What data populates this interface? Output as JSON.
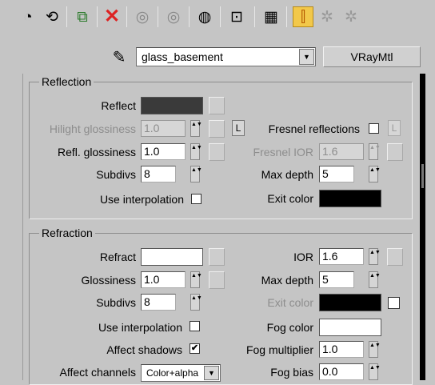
{
  "toolbar": {
    "icons": [
      {
        "name": "get-material-icon",
        "glyph": "◔"
      },
      {
        "name": "put-material-icon",
        "glyph": "⟲"
      },
      {
        "name": "assign-material-icon",
        "glyph": "⧉"
      },
      {
        "name": "reset-map-icon",
        "glyph": "✕"
      },
      {
        "name": "make-copy-icon",
        "glyph": "◎"
      },
      {
        "name": "make-unique-icon",
        "glyph": "◎"
      },
      {
        "name": "put-to-library-icon",
        "glyph": "◍"
      },
      {
        "name": "material-id-icon",
        "glyph": "⊡"
      },
      {
        "name": "show-map-icon",
        "glyph": "▦"
      },
      {
        "name": "show-end-result-icon",
        "glyph": "⫿"
      },
      {
        "name": "go-to-parent-icon",
        "glyph": "✲"
      },
      {
        "name": "go-forward-icon",
        "glyph": "✲"
      }
    ]
  },
  "material": {
    "name": "glass_basement",
    "type": "VRayMtl"
  },
  "reflection": {
    "title": "Reflection",
    "reflect_label": "Reflect",
    "reflect_color": "#3a3a3a",
    "hilight_glossiness_label": "Hilight glossiness",
    "hilight_glossiness_value": "1.0",
    "l_label": "L",
    "fresnel_reflections_label": "Fresnel reflections",
    "fresnel_reflections_checked": false,
    "refl_glossiness_label": "Refl. glossiness",
    "refl_glossiness_value": "1.0",
    "fresnel_ior_label": "Fresnel IOR",
    "fresnel_ior_value": "1.6",
    "subdivs_label": "Subdivs",
    "subdivs_value": "8",
    "max_depth_label": "Max depth",
    "max_depth_value": "5",
    "use_interpolation_label": "Use interpolation",
    "use_interpolation_checked": false,
    "exit_color_label": "Exit color",
    "exit_color": "#000000"
  },
  "refraction": {
    "title": "Refraction",
    "refract_label": "Refract",
    "refract_color": "#ffffff",
    "ior_label": "IOR",
    "ior_value": "1.6",
    "glossiness_label": "Glossiness",
    "glossiness_value": "1.0",
    "max_depth_label": "Max depth",
    "max_depth_value": "5",
    "subdivs_label": "Subdivs",
    "subdivs_value": "8",
    "exit_color_label": "Exit color",
    "exit_color": "#000000",
    "use_interpolation_label": "Use interpolation",
    "use_interpolation_checked": false,
    "fog_color_label": "Fog color",
    "fog_color": "#ffffff",
    "affect_shadows_label": "Affect shadows",
    "affect_shadows_checked": true,
    "fog_multiplier_label": "Fog multiplier",
    "fog_multiplier_value": "1.0",
    "affect_channels_label": "Affect channels",
    "affect_channels_value": "Color+alpha",
    "fog_bias_label": "Fog bias",
    "fog_bias_value": "0.0"
  },
  "glyphs": {
    "check": "✔",
    "spin": "▲▼",
    "dropdown": "▼",
    "eyedropper": "✎"
  }
}
